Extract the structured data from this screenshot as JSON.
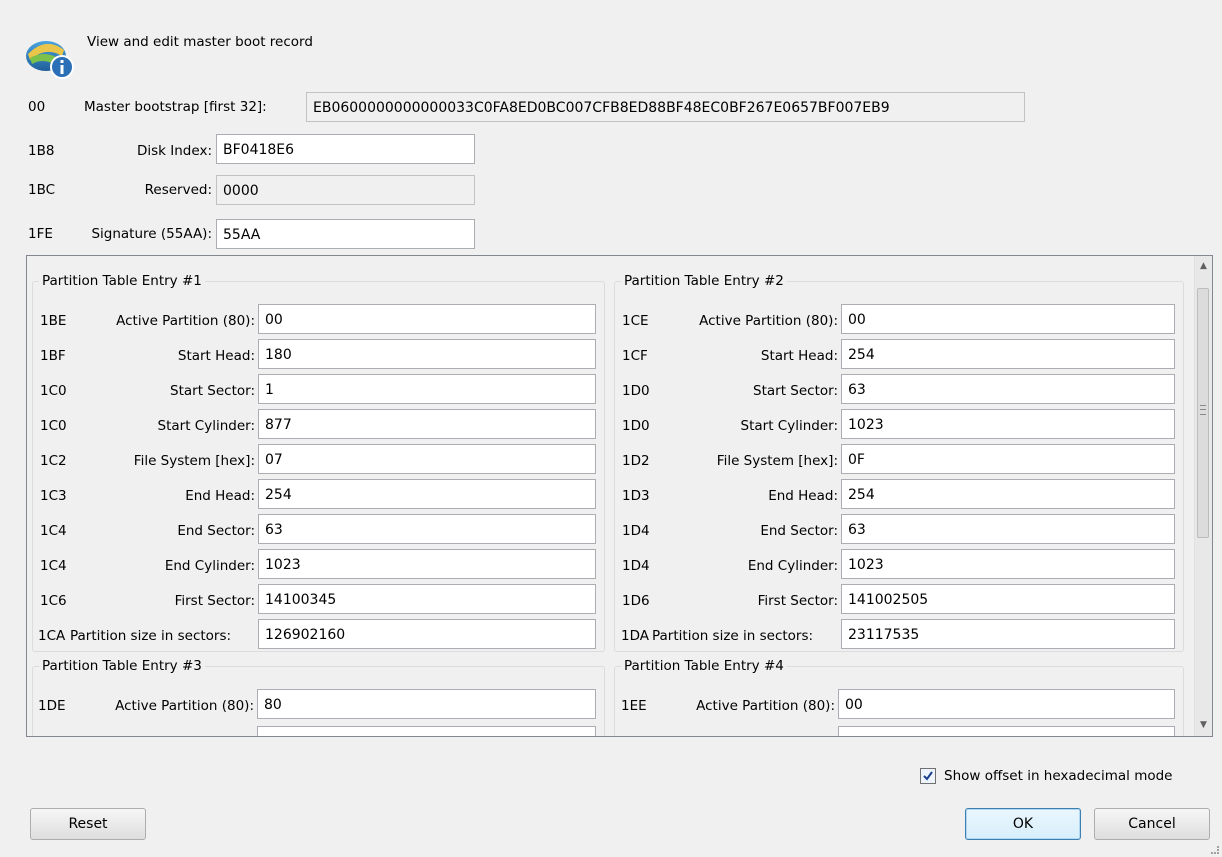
{
  "header": {
    "title": "View and edit master boot record"
  },
  "mbr": {
    "bootstrap": {
      "offset": "00",
      "label": "Master bootstrap [first 32]:",
      "value": "EB0600000000000033C0FA8ED0BC007CFB8ED88BF48EC0BF267E0657BF007EB9"
    },
    "disk_index": {
      "offset": "1B8",
      "label": "Disk Index:",
      "value": "BF0418E6"
    },
    "reserved": {
      "offset": "1BC",
      "label": "Reserved:",
      "value": "0000"
    },
    "signature": {
      "offset": "1FE",
      "label": "Signature (55AA):",
      "value": "55AA"
    }
  },
  "partitions": [
    {
      "title": "Partition Table Entry #1",
      "rows": [
        {
          "offset": "1BE",
          "label": "Active Partition (80):",
          "value": "00"
        },
        {
          "offset": "1BF",
          "label": "Start Head:",
          "value": "180"
        },
        {
          "offset": "1C0",
          "label": "Start Sector:",
          "value": "1"
        },
        {
          "offset": "1C0",
          "label": "Start Cylinder:",
          "value": "877"
        },
        {
          "offset": "1C2",
          "label": "File System [hex]:",
          "value": "07"
        },
        {
          "offset": "1C3",
          "label": "End Head:",
          "value": "254"
        },
        {
          "offset": "1C4",
          "label": "End Sector:",
          "value": "63"
        },
        {
          "offset": "1C4",
          "label": "End Cylinder:",
          "value": "1023"
        },
        {
          "offset": "1C6",
          "label": "First Sector:",
          "value": "14100345"
        },
        {
          "offset": "1CA",
          "label": "Partition size in sectors:",
          "value": "126902160"
        }
      ]
    },
    {
      "title": "Partition Table Entry #2",
      "rows": [
        {
          "offset": "1CE",
          "label": "Active Partition (80):",
          "value": "00"
        },
        {
          "offset": "1CF",
          "label": "Start Head:",
          "value": "254"
        },
        {
          "offset": "1D0",
          "label": "Start Sector:",
          "value": "63"
        },
        {
          "offset": "1D0",
          "label": "Start Cylinder:",
          "value": "1023"
        },
        {
          "offset": "1D2",
          "label": "File System [hex]:",
          "value": "0F"
        },
        {
          "offset": "1D3",
          "label": "End Head:",
          "value": "254"
        },
        {
          "offset": "1D4",
          "label": "End Sector:",
          "value": "63"
        },
        {
          "offset": "1D4",
          "label": "End Cylinder:",
          "value": "1023"
        },
        {
          "offset": "1D6",
          "label": "First Sector:",
          "value": "141002505"
        },
        {
          "offset": "1DA",
          "label": "Partition size in sectors:",
          "value": "23117535"
        }
      ]
    },
    {
      "title": "Partition Table Entry #3",
      "rows": [
        {
          "offset": "1DE",
          "label": "Active Partition (80):",
          "value": "80"
        }
      ]
    },
    {
      "title": "Partition Table Entry #4",
      "rows": [
        {
          "offset": "1EE",
          "label": "Active Partition (80):",
          "value": "00"
        }
      ]
    }
  ],
  "footer": {
    "hex_checkbox_label": "Show offset in hexadecimal mode",
    "hex_checked": true,
    "reset_label": "Reset",
    "ok_label": "OK",
    "cancel_label": "Cancel"
  },
  "colors": {
    "field_border": "#abadb3",
    "ok_border": "#3c7fb1",
    "background": "#f0f0f0"
  },
  "icons": [
    "disk-info-icon",
    "scroll-up-icon",
    "scroll-down-icon",
    "scroll-grip-icon",
    "checkbox-check-icon"
  ]
}
